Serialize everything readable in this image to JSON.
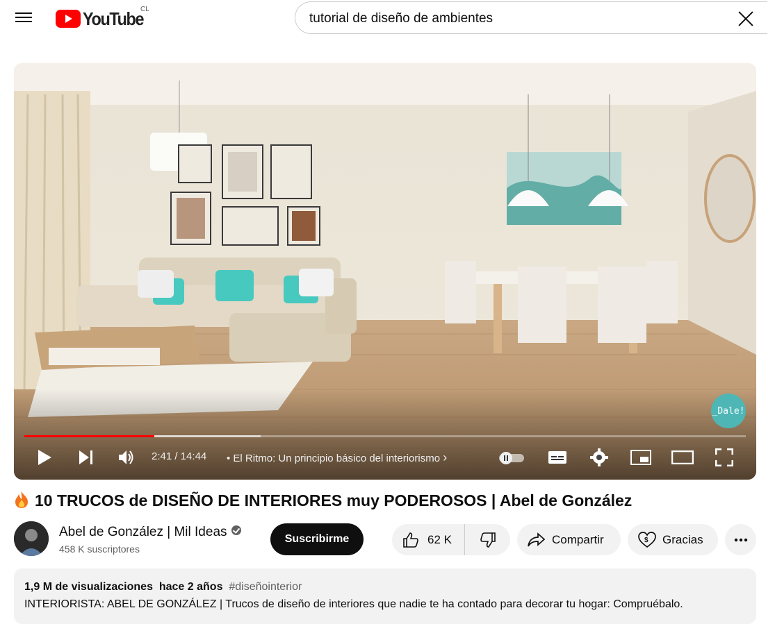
{
  "header": {
    "logo_text": "YouTube",
    "country_code": "CL",
    "search_value": "tutorial de diseño de ambientes"
  },
  "player": {
    "time_current": "2:41",
    "time_separator": " / ",
    "time_total": "14:44",
    "chapter_title": "• El Ritmo: Un principio básico del interiorismo",
    "watermark": "_Dale!",
    "progress_fraction": 0.18
  },
  "video": {
    "title": "10 TRUCOS de DISEÑO DE INTERIORES muy PODEROSOS | Abel de González",
    "channel_name": "Abel de González | Mil Ideas",
    "subscribers": "458 K suscriptores",
    "subscribe_label": "Suscribirme",
    "likes": "62 K",
    "share_label": "Compartir",
    "thanks_label": "Gracias"
  },
  "description": {
    "views": "1,9 M de visualizaciones",
    "age": "hace 2 años",
    "hashtag": "#diseñointerior",
    "text": "INTERIORISTA: ABEL DE GONZÁLEZ | Trucos de diseño de interiores que nadie te ha contado para decorar tu hogar: Compruébalo."
  },
  "colors": {
    "brand_red": "#ff0000",
    "progress_red": "#ff0000",
    "pill_bg": "#f2f2f2",
    "subscribe_bg": "#0f0f0f"
  }
}
